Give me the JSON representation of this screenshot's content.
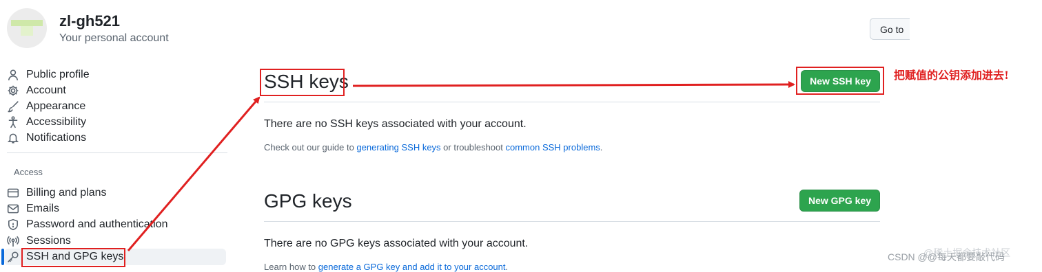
{
  "header": {
    "username": "zl-gh521",
    "subtitle": "Your personal account",
    "goto_label": "Go to"
  },
  "sidebar": {
    "items_top": [
      {
        "label": "Public profile",
        "icon": "person-icon"
      },
      {
        "label": "Account",
        "icon": "gear-icon"
      },
      {
        "label": "Appearance",
        "icon": "paintbrush-icon"
      },
      {
        "label": "Accessibility",
        "icon": "accessibility-icon"
      },
      {
        "label": "Notifications",
        "icon": "bell-icon"
      }
    ],
    "section_access": "Access",
    "items_access": [
      {
        "label": "Billing and plans",
        "icon": "credit-card-icon"
      },
      {
        "label": "Emails",
        "icon": "mail-icon"
      },
      {
        "label": "Password and authentication",
        "icon": "shield-icon"
      },
      {
        "label": "Sessions",
        "icon": "broadcast-icon"
      },
      {
        "label": "SSH and GPG keys",
        "icon": "key-icon"
      }
    ]
  },
  "ssh": {
    "title": "SSH keys",
    "new_button": "New SSH key",
    "empty": "There are no SSH keys associated with your account.",
    "help_prefix": "Check out our guide to ",
    "help_link1": "generating SSH keys",
    "help_mid": " or troubleshoot ",
    "help_link2": "common SSH problems",
    "help_suffix": "."
  },
  "gpg": {
    "title": "GPG keys",
    "new_button": "New GPG key",
    "empty": "There are no GPG keys associated with your account.",
    "help_prefix": "Learn how to ",
    "help_link": "generate a GPG key and add it to your account",
    "help_suffix": "."
  },
  "annotation": {
    "text": "把赋值的公钥添加进去!",
    "color": "#e02020"
  },
  "watermark": {
    "csdn": "CSDN @@每天都要敲代码",
    "juejin": "@稀土掘金技术社区"
  },
  "colors": {
    "accent": "#0969da",
    "button_green": "#2da44e"
  }
}
